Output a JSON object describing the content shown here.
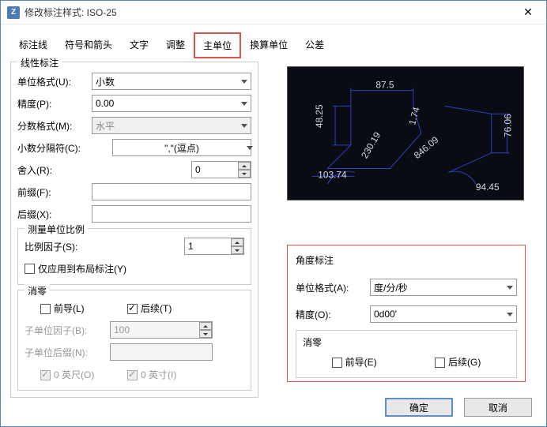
{
  "window": {
    "title": "修改标注样式: ISO-25"
  },
  "tabs": [
    "标注线",
    "符号和箭头",
    "文字",
    "调整",
    "主单位",
    "换算单位",
    "公差"
  ],
  "linear": {
    "legend": "线性标注",
    "unitFormat_lbl": "单位格式(U):",
    "unitFormat_val": "小数",
    "precision_lbl": "精度(P):",
    "precision_val": "0.00",
    "fraction_lbl": "分数格式(M):",
    "fraction_val": "水平",
    "decimal_lbl": "小数分隔符(C):",
    "decimal_val": "\",\"(逗点)",
    "round_lbl": "舍入(R):",
    "round_val": "0",
    "prefix_lbl": "前缀(F):",
    "prefix_val": "",
    "suffix_lbl": "后缀(X):",
    "suffix_val": ""
  },
  "scale": {
    "legend": "测量单位比例",
    "factor_lbl": "比例因子(S):",
    "factor_val": "1",
    "layout_lbl": "仅应用到布局标注(Y)"
  },
  "zero": {
    "legend": "消零",
    "leading": "前导(L)",
    "trailing": "后续(T)",
    "subFactor_lbl": "子单位因子(B):",
    "subFactor_val": "100",
    "subSuffix_lbl": "子单位后缀(N):",
    "subSuffix_val": "",
    "feet": "0 英尺(O)",
    "inch": "0 英寸(I)"
  },
  "angular": {
    "legend": "角度标注",
    "unitFormat_lbl": "单位格式(A):",
    "unitFormat_val": "度/分/秒",
    "precision_lbl": "精度(O):",
    "precision_val": "0d00'",
    "zero_legend": "消零",
    "leading": "前导(E)",
    "trailing": "后续(G)"
  },
  "preview": {
    "d1": "87.5",
    "d2": "48.25",
    "d3": "230.19",
    "d4": "103.74",
    "d5": "76.06",
    "d6": "94.45",
    "d7": "1.74",
    "d8": "846.09"
  },
  "buttons": {
    "ok": "确定",
    "cancel": "取消"
  }
}
